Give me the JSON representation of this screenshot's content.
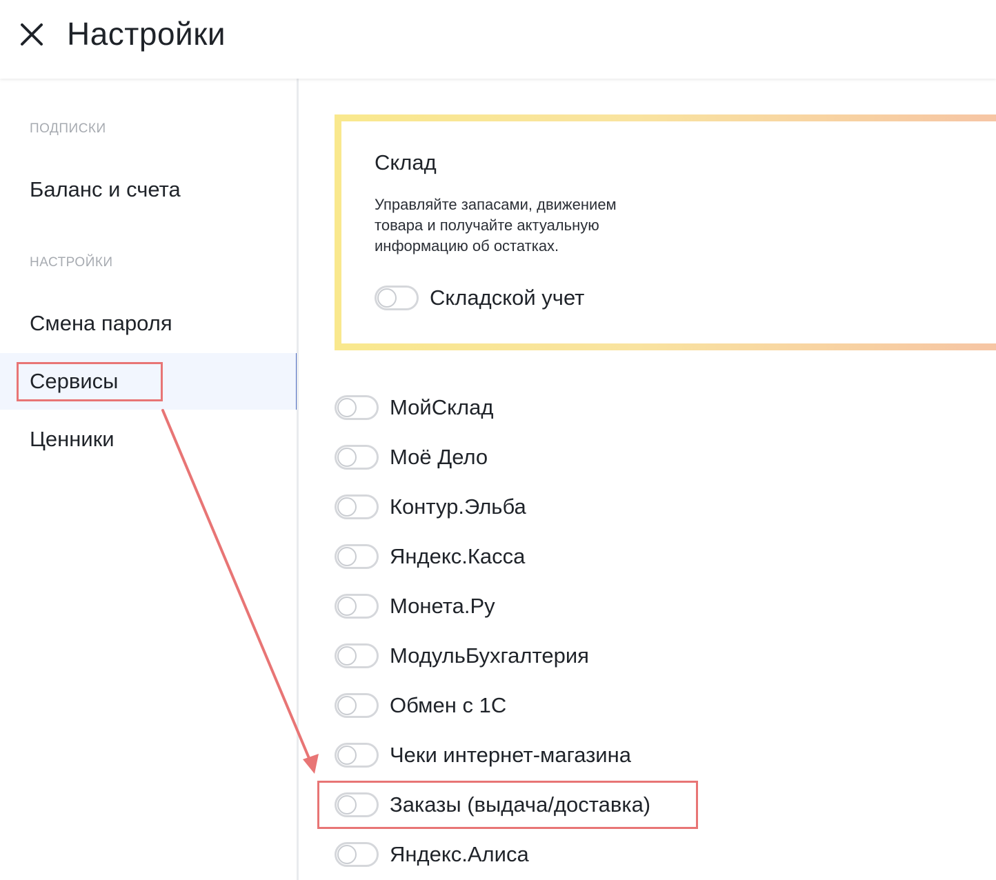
{
  "header": {
    "title": "Настройки",
    "close_icon": "close-icon"
  },
  "sidebar": {
    "sections": [
      {
        "label": "ПОДПИСКИ",
        "items": [
          {
            "label": "Баланс и счета",
            "active": false
          }
        ]
      },
      {
        "label": "НАСТРОЙКИ",
        "items": [
          {
            "label": "Смена пароля",
            "active": false
          },
          {
            "label": "Сервисы",
            "active": true
          },
          {
            "label": "Ценники",
            "active": false
          }
        ]
      }
    ]
  },
  "promo": {
    "title": "Склад",
    "description": "Управляйте запасами, движением товара и получайте актуальную информацию об остатках.",
    "toggle_label": "Складской учет",
    "toggle_on": false
  },
  "services": [
    {
      "label": "МойСклад",
      "on": false
    },
    {
      "label": "Моё Дело",
      "on": false
    },
    {
      "label": "Контур.Эльба",
      "on": false
    },
    {
      "label": "Яндекс.Касса",
      "on": false
    },
    {
      "label": "Монета.Ру",
      "on": false
    },
    {
      "label": "МодульБухгалтерия",
      "on": false
    },
    {
      "label": "Обмен с 1С",
      "on": false
    },
    {
      "label": "Чеки интернет-магазина",
      "on": false
    },
    {
      "label": "Заказы (выдача/доставка)",
      "on": false
    },
    {
      "label": "Яндекс.Алиса",
      "on": false
    }
  ],
  "colors": {
    "accent": "#4d6bc1",
    "active_bg": "#f2f6fe",
    "annotation": "#e87575",
    "promo_gradient_start": "#f9e88d",
    "promo_gradient_end": "#f6c4a4"
  }
}
